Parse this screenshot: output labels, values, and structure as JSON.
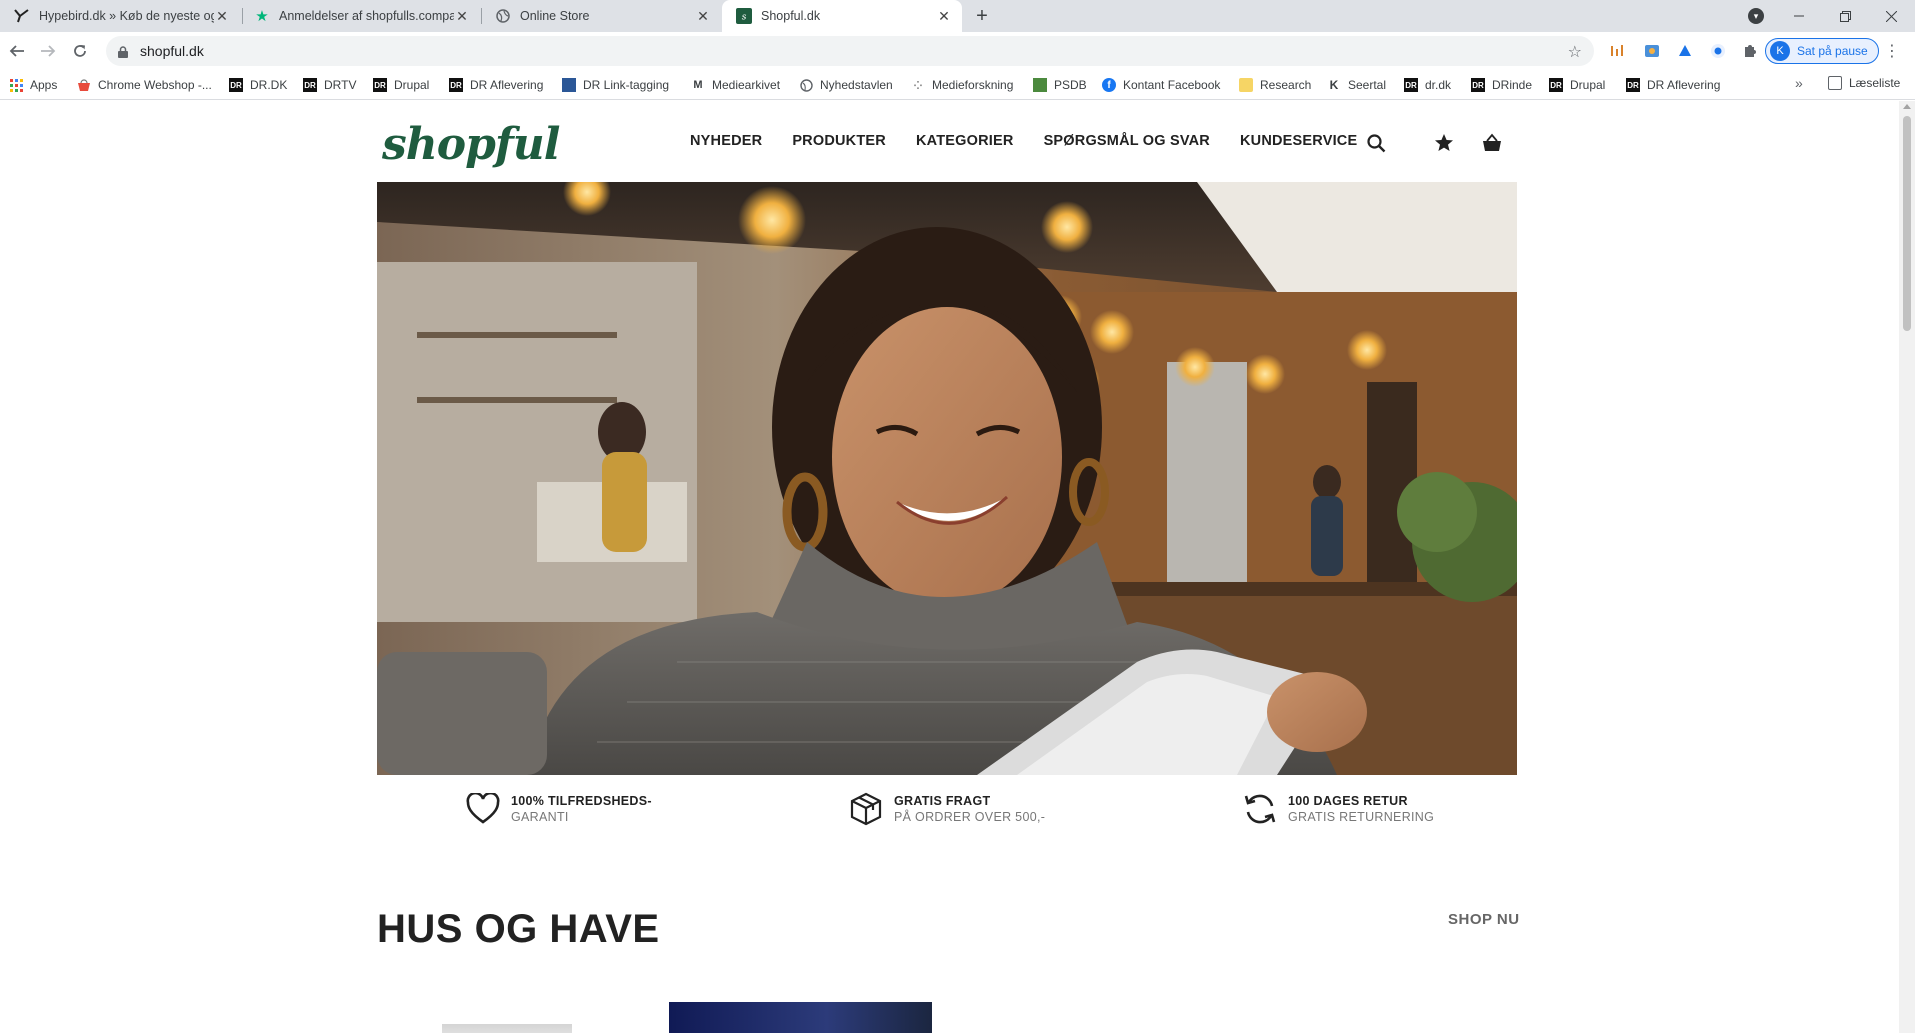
{
  "browser": {
    "tabs": [
      {
        "title": "Hypebird.dk » Køb de nyeste og",
        "favicon": "hypebird-icon",
        "active": false
      },
      {
        "title": "Anmeldelser af shopfulls.compan",
        "favicon": "trustpilot-star-icon",
        "active": false
      },
      {
        "title": "Online Store",
        "favicon": "globe-icon",
        "active": false
      },
      {
        "title": "Shopful.dk",
        "favicon": "shopful-icon",
        "active": true
      }
    ],
    "url": "shopful.dk",
    "profile_status": "Sat på pause",
    "profile_initial": "K",
    "bookmarks": [
      {
        "label": "Apps",
        "icon": "apps-grid-icon"
      },
      {
        "label": "Chrome Webshop -...",
        "icon": "webstore-icon"
      },
      {
        "label": "DR.DK",
        "icon": "dr-icon"
      },
      {
        "label": "DRTV",
        "icon": "dr-icon"
      },
      {
        "label": "Drupal",
        "icon": "dr-icon"
      },
      {
        "label": "DR Aflevering",
        "icon": "dr-icon"
      },
      {
        "label": "DR Link-tagging",
        "icon": "link-tagging-icon"
      },
      {
        "label": "Mediearkivet",
        "icon": "m-icon"
      },
      {
        "label": "Nyhedstavlen",
        "icon": "globe-icon"
      },
      {
        "label": "Medieforskning",
        "icon": "dots-icon"
      },
      {
        "label": "PSDB",
        "icon": "psdb-icon"
      },
      {
        "label": "Kontant Facebook",
        "icon": "facebook-icon"
      },
      {
        "label": "Research",
        "icon": "folder-icon"
      },
      {
        "label": "Seertal",
        "icon": "k-icon"
      },
      {
        "label": "dr.dk",
        "icon": "dr-icon"
      },
      {
        "label": "DRinde",
        "icon": "dr-icon"
      },
      {
        "label": "Drupal",
        "icon": "dr-icon"
      },
      {
        "label": "DR Aflevering",
        "icon": "dr-icon"
      }
    ],
    "reading_list": "Læseliste"
  },
  "site": {
    "logo": "shopful",
    "nav": [
      "NYHEDER",
      "PRODUKTER",
      "KATEGORIER",
      "SPØRGSMÅL OG SVAR",
      "KUNDESERVICE"
    ],
    "usps": [
      {
        "title": "100% TILFREDSHEDS-",
        "subtitle": "GARANTI",
        "icon": "heart-icon"
      },
      {
        "title": "GRATIS FRAGT",
        "subtitle": "PÅ ORDRER OVER 500,-",
        "icon": "box-icon"
      },
      {
        "title": "100 DAGES RETUR",
        "subtitle": "GRATIS RETURNERING",
        "icon": "refresh-icon"
      }
    ],
    "section_title": "HUS OG HAVE",
    "shop_now": "SHOP NU"
  },
  "colors": {
    "brand_green": "#1f5c3f",
    "accent_blue": "#1a73e8"
  }
}
